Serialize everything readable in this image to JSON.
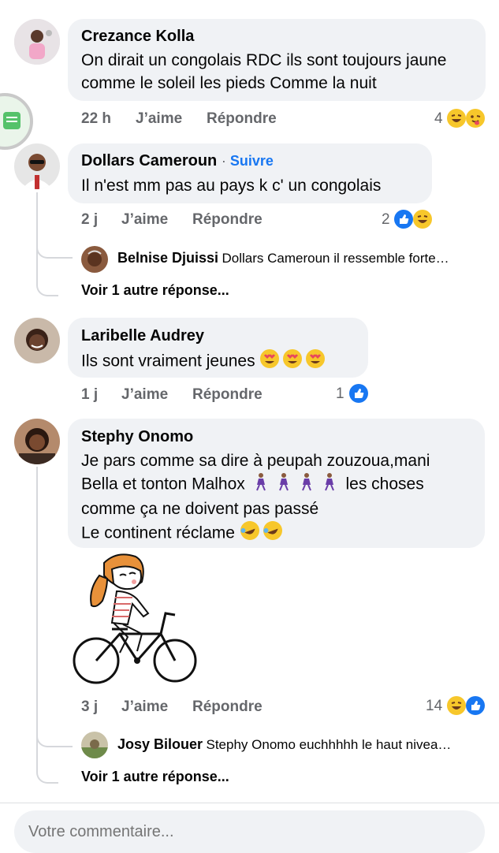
{
  "comments": [
    {
      "author": "Crezance Kolla",
      "text": "On dirait un congolais RDC ils sont toujours jaune comme le soleil les pieds Comme la nuit",
      "time": "22 h",
      "like_label": "J’aime",
      "reply_label": "Répondre",
      "reaction_count": "4",
      "reactions": [
        "laugh-emoji",
        "yum-emoji"
      ]
    },
    {
      "author": "Dollars Cameroun",
      "follow_label": "Suivre",
      "text": "Il n'est mm pas au pays k c' un congolais",
      "time": "2 j",
      "like_label": "J’aime",
      "reply_label": "Répondre",
      "reaction_count": "2",
      "reactions": [
        "like-emoji",
        "laugh-emoji"
      ],
      "reply_preview": {
        "author": "Belnise Djuissi",
        "text": "Dollars Cameroun il ressemble forte…"
      },
      "more_replies": "Voir 1 autre réponse..."
    },
    {
      "author": "Laribelle Audrey",
      "text": "Ils sont vraiment jeunes",
      "time": "1 j",
      "like_label": "J’aime",
      "reply_label": "Répondre",
      "reaction_count": "1",
      "reactions": [
        "like-emoji"
      ]
    },
    {
      "author": "Stephy Onomo",
      "text_lines": [
        "Je pars comme sa dire à peupah zouzoua,mani",
        "Bella et tonton Malhox",
        "les choses",
        "comme ça ne doivent pas passé",
        "Le continent réclame"
      ],
      "time": "3 j",
      "like_label": "J’aime",
      "reply_label": "Répondre",
      "reaction_count": "14",
      "reactions": [
        "laugh-emoji",
        "like-emoji"
      ],
      "reply_preview": {
        "author": "Josy Bilouer",
        "text": "Stephy Onomo euchhhhh le haut nivea…"
      },
      "more_replies": "Voir 1 autre réponse..."
    }
  ],
  "composer": {
    "placeholder": "Votre commentaire..."
  },
  "colors": {
    "bubble": "#f0f2f5",
    "link": "#1877f2",
    "meta": "#65676b",
    "like_blue": "#1877f2",
    "emoji_yellow": "#f7c72b"
  }
}
